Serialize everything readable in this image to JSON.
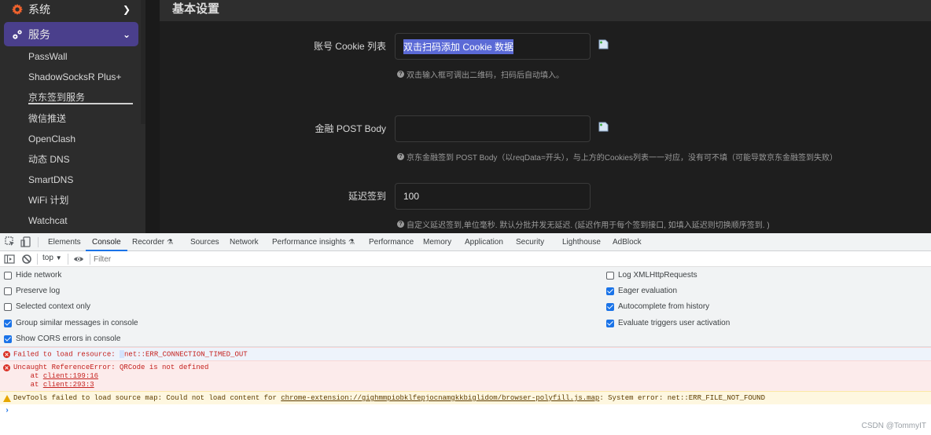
{
  "sidebar": {
    "top_items": [
      {
        "label": "系统",
        "icon": "gear-icon",
        "icon_color": "#f0622d",
        "expanded": false
      },
      {
        "label": "服务",
        "icon": "cogs-icon",
        "expanded": true
      }
    ],
    "sub_items": [
      {
        "label": "PassWall"
      },
      {
        "label": "ShadowSocksR Plus+"
      },
      {
        "label": "京东签到服务",
        "active": true
      },
      {
        "label": "微信推送"
      },
      {
        "label": "OpenClash"
      },
      {
        "label": "动态 DNS"
      },
      {
        "label": "SmartDNS"
      },
      {
        "label": "WiFi 计划"
      },
      {
        "label": "Watchcat"
      }
    ],
    "active_color": "#4a3f8c"
  },
  "content": {
    "section_title": "基本设置",
    "fields": [
      {
        "label": "账号 Cookie 列表",
        "value": "双击扫码添加 Cookie 数据",
        "selected": true,
        "help": "双击输入框可调出二维码，扫码后自动填入。"
      },
      {
        "label": "金融 POST Body",
        "value": "",
        "help": "京东金融签到 POST Body（以reqData=开头），与上方的Cookies列表一一对应，没有可不填（可能导致京东金融签到失败）"
      },
      {
        "label": "延迟签到",
        "value": "100",
        "help": "自定义延迟签到,单位毫秒. 默认分批并发无延迟. (延迟作用于每个签到接口, 如填入延迟则切换顺序签到. )"
      }
    ]
  },
  "devtools": {
    "tabs": [
      {
        "label": "Elements"
      },
      {
        "label": "Console",
        "active": true
      },
      {
        "label": "Recorder",
        "experimental": true
      },
      {
        "label": "Sources"
      },
      {
        "label": "Network"
      },
      {
        "label": "Performance insights",
        "experimental": true
      },
      {
        "label": "Performance"
      },
      {
        "label": "Memory"
      },
      {
        "label": "Application"
      },
      {
        "label": "Security"
      },
      {
        "label": "Lighthouse"
      },
      {
        "label": "AdBlock"
      }
    ],
    "toolbar": {
      "context": "top",
      "filter_placeholder": "Filter"
    },
    "settings_left": [
      {
        "label": "Hide network",
        "checked": false
      },
      {
        "label": "Preserve log",
        "checked": false
      },
      {
        "label": "Selected context only",
        "checked": false
      },
      {
        "label": "Group similar messages in console",
        "checked": true
      },
      {
        "label": "Show CORS errors in console",
        "checked": true
      }
    ],
    "settings_right": [
      {
        "label": "Log XMLHttpRequests",
        "checked": false
      },
      {
        "label": "Eager evaluation",
        "checked": true
      },
      {
        "label": "Autocomplete from history",
        "checked": true
      },
      {
        "label": "Evaluate triggers user activation",
        "checked": true
      }
    ],
    "messages": {
      "error1": {
        "prefix": "Failed to load resource: ",
        "detail": "net::ERR_CONNECTION_TIMED_OUT"
      },
      "error2": {
        "text": "Uncaught ReferenceError: QRCode is not defined",
        "at_prefix": "    at ",
        "stack": [
          "client:199:16",
          "client:293:3"
        ]
      },
      "warning": {
        "prefix": "DevTools failed to load source map: Could not load content for ",
        "link": "chrome-extension://gighmmpiobklfepjocnamgkkbiglidom/browser-polyfill.js.map",
        "suffix": ": System error: net::ERR_FILE_NOT_FOUND"
      }
    },
    "prompt": "›"
  },
  "watermark": "CSDN @TommyIT"
}
